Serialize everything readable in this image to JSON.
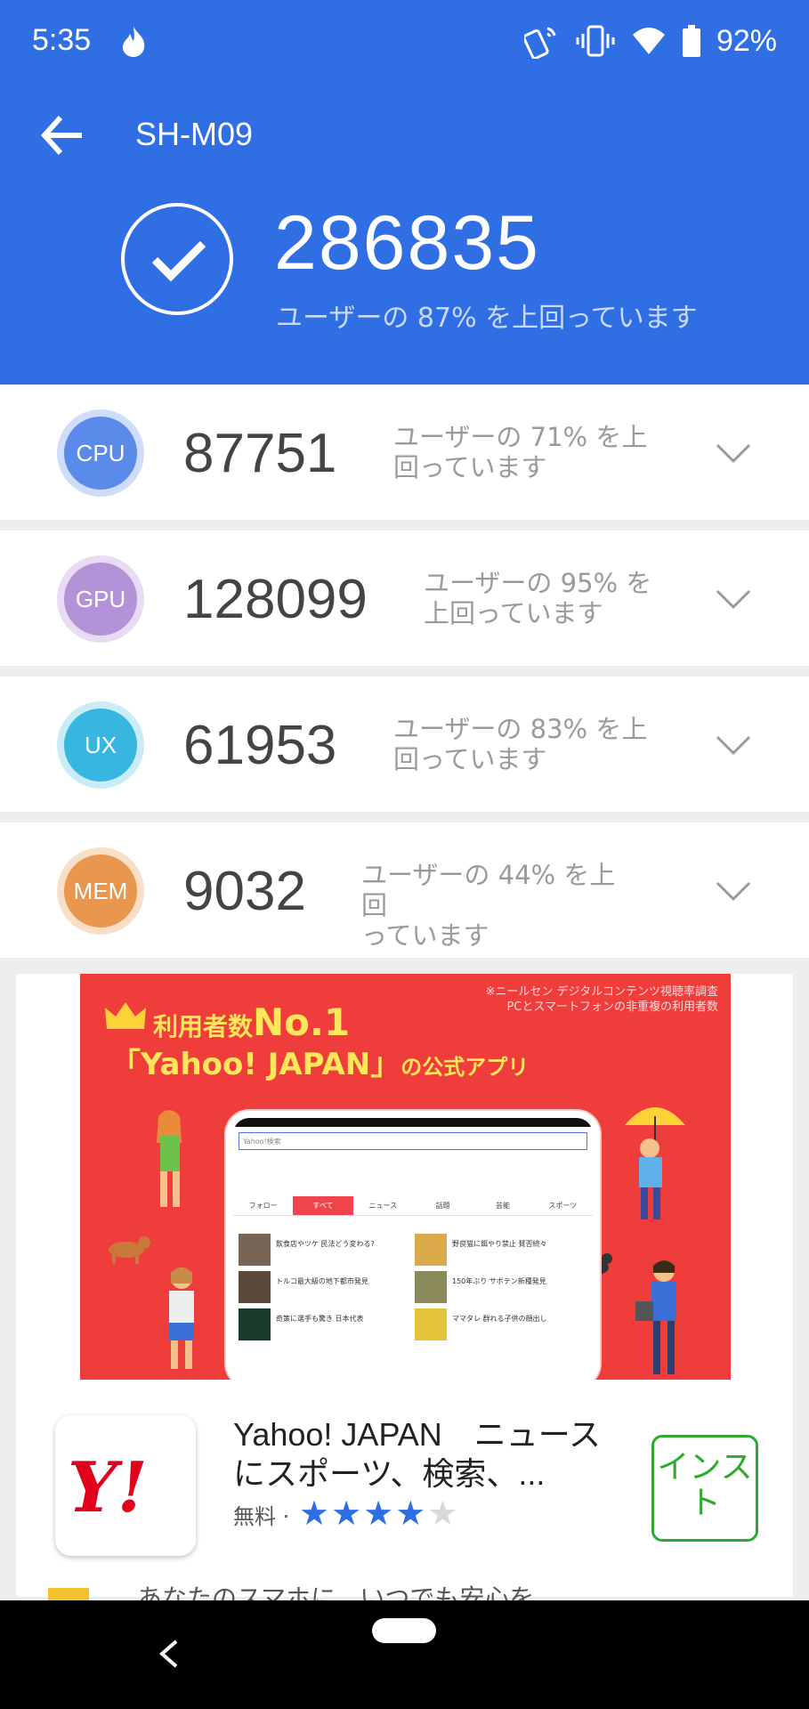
{
  "status_bar": {
    "time": "5:35",
    "battery": "92%",
    "icons": [
      "flame-icon",
      "nfc-icon",
      "vibrate-icon",
      "wifi-icon",
      "battery-icon"
    ]
  },
  "header": {
    "device": "SH-M09",
    "total_score": "286835",
    "total_text": "ユーザーの 87% を上回っています"
  },
  "scores": [
    {
      "label": "CPU",
      "score": "87751",
      "text1": "ユーザーの 71% を上",
      "text2": "回っています",
      "color": "#5b8bea",
      "ring": "#cfdcfa"
    },
    {
      "label": "GPU",
      "score": "128099",
      "text1": "ユーザーの 95% を",
      "text2": "上回っています",
      "color": "#b492d8",
      "ring": "#e8dcf5"
    },
    {
      "label": "UX",
      "score": "61953",
      "text1": "ユーザーの 83% を上",
      "text2": "回っています",
      "color": "#37b6e0",
      "ring": "#c9ecf7"
    },
    {
      "label": "MEM",
      "score": "9032",
      "text1": "ユーザーの 44% を上回",
      "text2": "っています",
      "color": "#e9974f",
      "ring": "#f9dfc8"
    }
  ],
  "ad": {
    "note1": "※ニールセン デジタルコンテンツ視聴率調査",
    "note2": "PCとスマートフォンの非重複の利用者数",
    "headline_a": "利用者数",
    "headline_b": "No.1",
    "headline_c": "「Yahoo! JAPAN」",
    "headline_d": "の公式アプリ",
    "tablet_search": "Yahoo!検索",
    "tablet_tabs": [
      "フォロー",
      "すべて",
      "ニュース",
      "話題",
      "芸能",
      "スポーツ"
    ],
    "news": [
      "飲食店やツケ 民法どう変わる?",
      "野良猫に餌やり禁止 賛否続々",
      "トルコ最大級の地下都市発見",
      "150年ぶり サボテン新種発見",
      "奇策に選手も驚き 日本代表",
      "ママタレ 群れる子供の顔出し"
    ],
    "app_logo": "Y!",
    "app_title": "Yahoo! JAPAN　ニュースにスポーツ、検索、...",
    "app_price": "無料 ·",
    "rating": 4,
    "install": "インスト",
    "bottom_text": "あなたのスマホに、いつでも安心を"
  }
}
